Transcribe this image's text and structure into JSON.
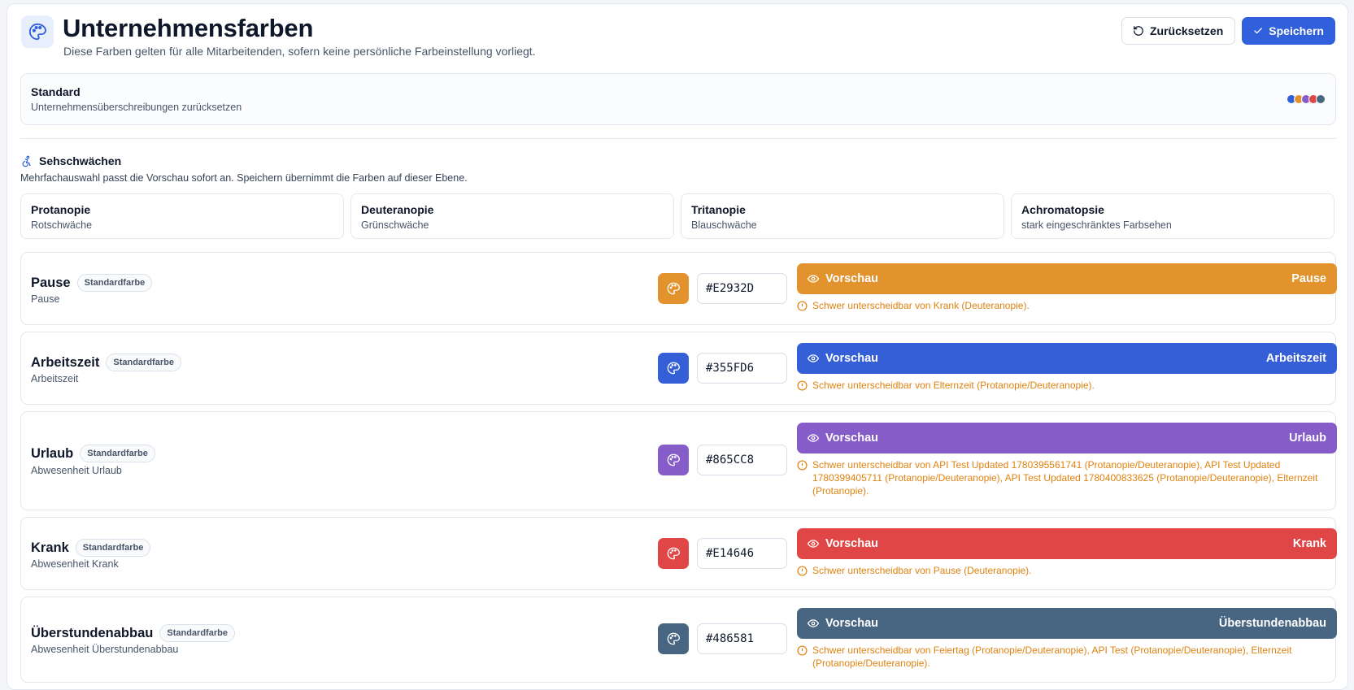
{
  "header": {
    "title": "Unternehmensfarben",
    "subtitle": "Diese Farben gelten für alle Mitarbeitenden, sofern keine persönliche Farbeinstellung vorliegt.",
    "icon": "palette-icon",
    "reset_label": "Zurücksetzen",
    "save_label": "Speichern"
  },
  "standard": {
    "title": "Standard",
    "subtitle": "Unternehmensüberschreibungen zurücksetzen",
    "dot_colors": [
      "#3160dc",
      "#e2932d",
      "#865cc8",
      "#e14646",
      "#486581"
    ]
  },
  "vision": {
    "title": "Sehschwächen",
    "icon": "accessibility-icon",
    "description": "Mehrfachauswahl passt die Vorschau sofort an. Speichern übernimmt die Farben auf dieser Ebene.",
    "options": [
      {
        "title": "Protanopie",
        "subtitle": "Rotschwäche"
      },
      {
        "title": "Deuteranopie",
        "subtitle": "Grünschwäche"
      },
      {
        "title": "Tritanopie",
        "subtitle": "Blauschwäche"
      },
      {
        "title": "Achromatopsie",
        "subtitle": "stark eingeschränktes Farbsehen"
      }
    ]
  },
  "preview_label": "Vorschau",
  "badge_label": "Standardfarbe",
  "colors": [
    {
      "name": "Pause",
      "subtitle": "Pause",
      "hex": "#E2932D",
      "color": "#e2932d",
      "preview_name": "Pause",
      "warning": "Schwer unterscheidbar von Krank (Deuteranopie)."
    },
    {
      "name": "Arbeitszeit",
      "subtitle": "Arbeitszeit",
      "hex": "#355FD6",
      "color": "#355fd6",
      "preview_name": "Arbeitszeit",
      "warning": "Schwer unterscheidbar von Elternzeit (Protanopie/Deuteranopie)."
    },
    {
      "name": "Urlaub",
      "subtitle": "Abwesenheit Urlaub",
      "hex": "#865CC8",
      "color": "#865cc8",
      "preview_name": "Urlaub",
      "warning": "Schwer unterscheidbar von API Test Updated 1780395561741 (Protanopie/Deuteranopie), API Test Updated 1780399405711 (Protanopie/Deuteranopie), API Test Updated 1780400833625 (Protanopie/Deuteranopie), Elternzeit (Protanopie)."
    },
    {
      "name": "Krank",
      "subtitle": "Abwesenheit Krank",
      "hex": "#E14646",
      "color": "#e14646",
      "preview_name": "Krank",
      "warning": "Schwer unterscheidbar von Pause (Deuteranopie)."
    },
    {
      "name": "Überstundenabbau",
      "subtitle": "Abwesenheit Überstundenabbau",
      "hex": "#486581",
      "color": "#486581",
      "preview_name": "Überstundenabbau",
      "warning": "Schwer unterscheidbar von Feiertag (Protanopie/Deuteranopie), API Test (Protanopie/Deuteranopie), Elternzeit (Protanopie/Deuteranopie)."
    }
  ],
  "accent_color": "#3160dc",
  "warning_color": "#e0820f"
}
